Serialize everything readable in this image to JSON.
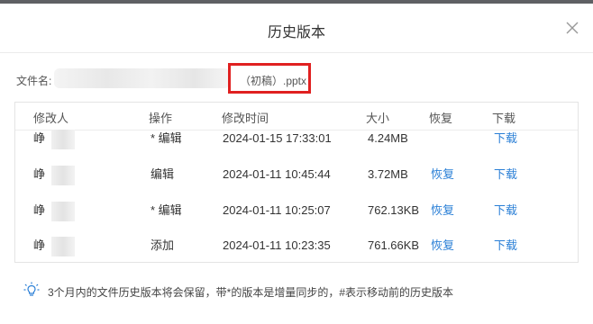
{
  "dialog": {
    "title": "历史版本",
    "close_icon": "close-icon"
  },
  "file": {
    "label": "文件名:",
    "name_suffix": "（初稿）.pptx"
  },
  "table": {
    "headers": [
      "修改人",
      "操作",
      "修改时间",
      "大小",
      "恢复",
      "下载"
    ],
    "rows": [
      {
        "modifier": "峥",
        "operation": "* 编辑",
        "time": "2024-01-15 17:33:01",
        "size": "4.24MB",
        "restore": "",
        "download": "下载"
      },
      {
        "modifier": "峥",
        "operation": "编辑",
        "time": "2024-01-11 10:45:44",
        "size": "3.72MB",
        "restore": "恢复",
        "download": "下载"
      },
      {
        "modifier": "峥",
        "operation": "* 编辑",
        "time": "2024-01-11 10:25:07",
        "size": "762.13KB",
        "restore": "恢复",
        "download": "下载"
      },
      {
        "modifier": "峥",
        "operation": "添加",
        "time": "2024-01-11 10:23:35",
        "size": "761.66KB",
        "restore": "恢复",
        "download": "下载"
      }
    ]
  },
  "tip": {
    "icon": "lightbulb-icon",
    "text": "3个月内的文件历史版本将会保留，带*的版本是增量同步的，#表示移动前的历史版本"
  },
  "colors": {
    "link": "#2a7fd6",
    "highlight": "#e02020",
    "tip_icon": "#2a7fd6"
  }
}
